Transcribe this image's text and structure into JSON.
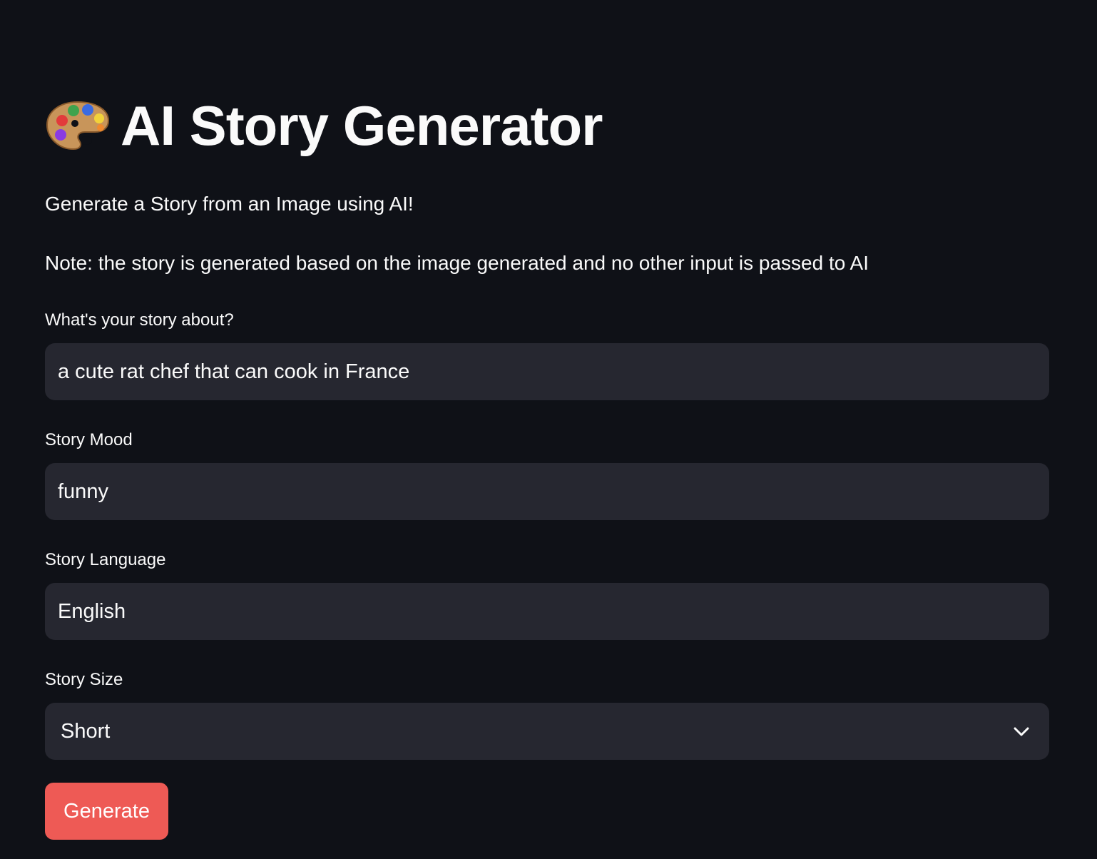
{
  "header": {
    "icon": "palette-icon",
    "title": "AI Story Generator"
  },
  "intro": {
    "subtitle": "Generate a Story from an Image using AI!",
    "note": "Note: the story is generated based on the image generated and no other input is passed to AI"
  },
  "form": {
    "story_about": {
      "label": "What's your story about?",
      "value": "a cute rat chef that can cook in France"
    },
    "story_mood": {
      "label": "Story Mood",
      "value": "funny"
    },
    "story_language": {
      "label": "Story Language",
      "value": "English"
    },
    "story_size": {
      "label": "Story Size",
      "selected": "Short",
      "icon": "chevron-down-icon"
    },
    "generate_label": "Generate"
  },
  "colors": {
    "background": "#0f1117",
    "input_background": "#262730",
    "text": "#fafafa",
    "primary_button": "#ee5a55"
  }
}
